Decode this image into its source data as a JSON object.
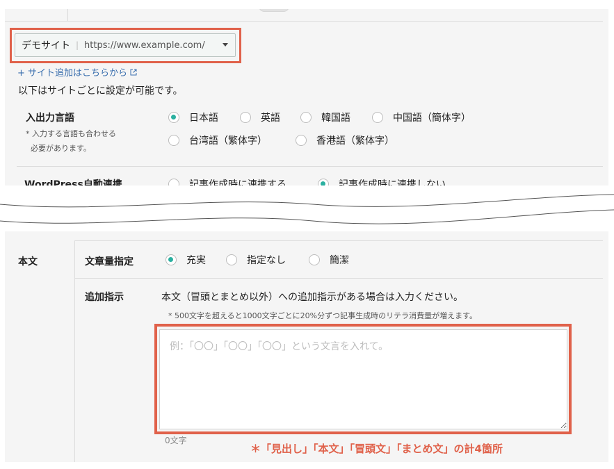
{
  "site_selector": {
    "site_name": "デモサイト",
    "divider": "|",
    "site_url": "https://www.example.com/"
  },
  "add_site_link": "+ サイト追加はこちらから",
  "intro_text": "以下はサイトごとに設定が可能です。",
  "language": {
    "label": "入出力言語",
    "note_line1": "* 入力する言語も合わせる",
    "note_line2": "必要があります。",
    "options": [
      "日本語",
      "英語",
      "韓国語",
      "中国語（簡体字）",
      "台湾語（繁体字）",
      "香港語（繁体字）"
    ],
    "selected": "日本語"
  },
  "wordpress": {
    "label": "WordPress自動連携",
    "options": [
      "記事作成時に連携する",
      "記事作成時に連携しない"
    ],
    "selected": "記事作成時に連携しない"
  },
  "body_section": {
    "label": "本文",
    "volume_label": "文章量指定",
    "volume_options": [
      "充実",
      "指定なし",
      "簡潔"
    ],
    "volume_selected": "充実",
    "additional_label": "追加指示",
    "additional_description": "本文（冒頭とまとめ以外）への追加指示がある場合は入力ください。",
    "additional_note": "* 500文字を超えると1000文字ごとに20%分ずつ記事生成時のリテラ消費量が増えます。",
    "textarea_placeholder": "例：「〇〇」「〇〇」「〇〇」という文言を入れて。",
    "char_count": "0文字"
  },
  "footnote": "＊「見出し」「本文」「冒頭文」「まとめ文」の計4箇所",
  "colors": {
    "highlight_border": "#e0614a",
    "radio_checked": "#2bb0a0",
    "link": "#3a6fae"
  }
}
